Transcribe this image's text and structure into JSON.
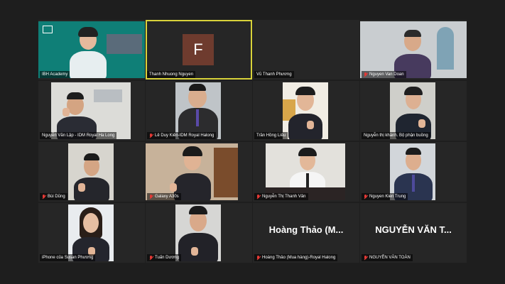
{
  "meeting": {
    "tiles": [
      {
        "name": "IBH Academy",
        "muted": false,
        "active": false,
        "type": "video"
      },
      {
        "name": "Thanh Nhuong Nguyen",
        "muted": false,
        "active": true,
        "type": "avatar",
        "initial": "F"
      },
      {
        "name": "Vũ Thanh Phương",
        "muted": false,
        "active": false,
        "type": "blank"
      },
      {
        "name": "Nguyen Van Doan",
        "muted": true,
        "active": false,
        "type": "video"
      },
      {
        "name": "Nguyễn Văn Lập - IDM Royal Ha Long",
        "muted": false,
        "active": false,
        "type": "video"
      },
      {
        "name": "Lê Duy Kiên-IDM Royal Halong",
        "muted": true,
        "active": false,
        "type": "video"
      },
      {
        "name": "Trần Hồng Liêu",
        "muted": false,
        "active": false,
        "type": "video"
      },
      {
        "name": "Nguyễn thị khánh. Bộ phận buồng",
        "muted": false,
        "active": false,
        "type": "video"
      },
      {
        "name": "Bùi Dũng",
        "muted": true,
        "active": false,
        "type": "video"
      },
      {
        "name": "Galaxy A30s",
        "muted": true,
        "active": false,
        "type": "video"
      },
      {
        "name": "Nguyễn Thị Thanh Vân",
        "muted": true,
        "active": false,
        "type": "video"
      },
      {
        "name": "Nguyen Kien Trung",
        "muted": true,
        "active": false,
        "type": "video"
      },
      {
        "name": "iPhone của Susan Phương",
        "muted": false,
        "active": false,
        "type": "video"
      },
      {
        "name": "Tuấn Dương",
        "muted": true,
        "active": false,
        "type": "video"
      },
      {
        "name": "Hoàng Thảo (Mua hàng)-Royal Halong",
        "muted": true,
        "active": false,
        "type": "nameonly",
        "display": "Hoàng Thảo (M..."
      },
      {
        "name": "NGUYỄN VĂN TOÀN",
        "muted": true,
        "active": false,
        "type": "nameonly",
        "display": "NGUYỄN VĂN T..."
      }
    ]
  }
}
